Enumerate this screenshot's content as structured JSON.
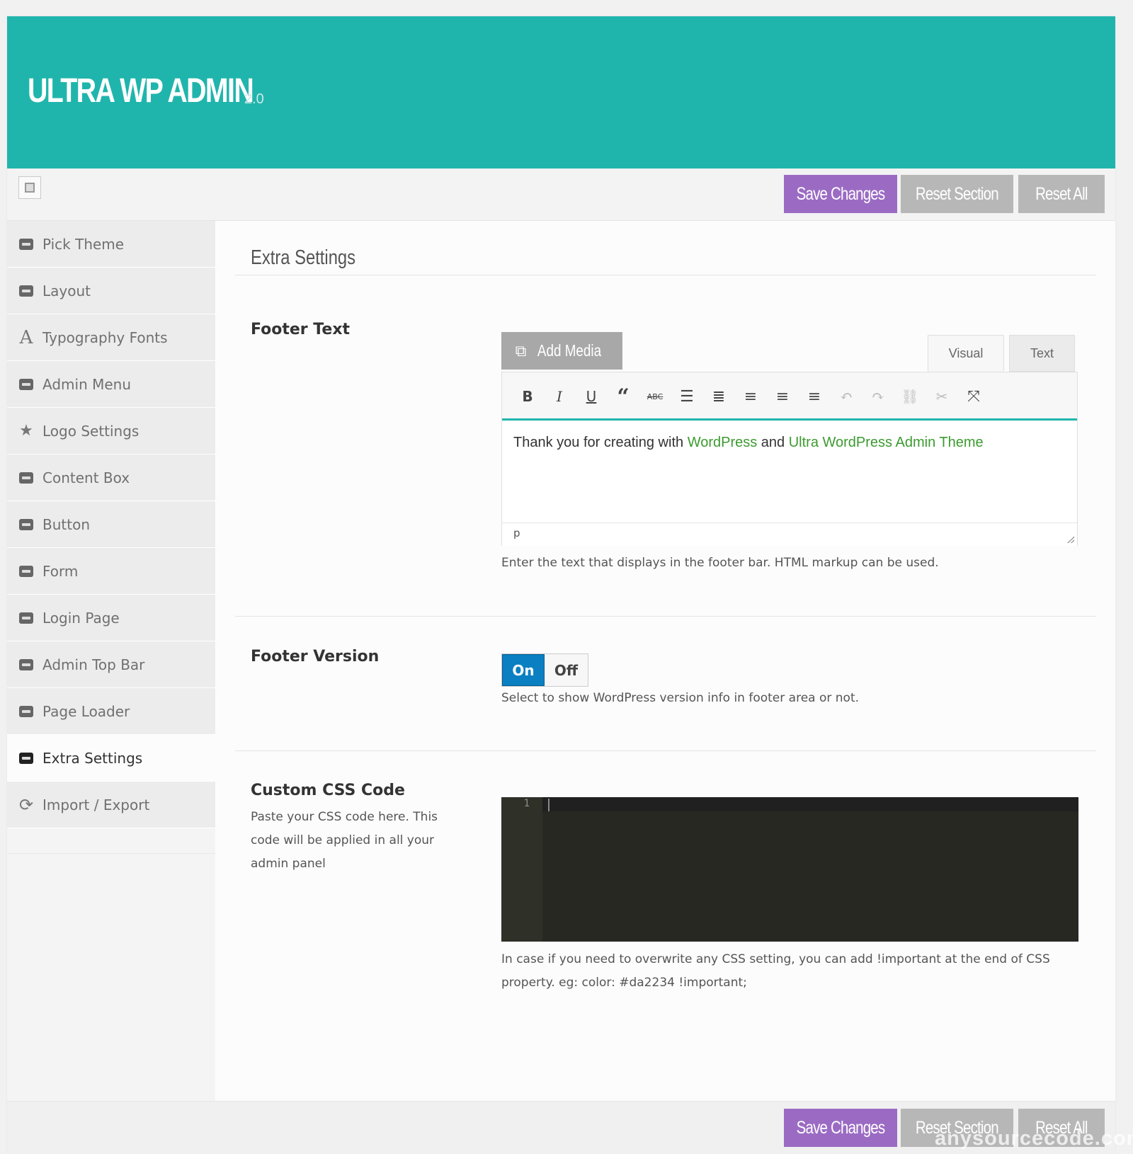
{
  "header": {
    "title": "ULTRA WP ADMIN",
    "version": "2.0",
    "background": "#20b5ac"
  },
  "toolbar": {
    "save_label": "Save Changes",
    "reset_section_label": "Reset Section",
    "reset_all_label": "Reset All"
  },
  "sidebar": {
    "items": [
      {
        "label": "Pick Theme",
        "icon": "css-icon"
      },
      {
        "label": "Layout",
        "icon": "css-icon"
      },
      {
        "label": "Typography Fonts",
        "icon": "font-icon"
      },
      {
        "label": "Admin Menu",
        "icon": "css-icon"
      },
      {
        "label": "Logo Settings",
        "icon": "star-icon"
      },
      {
        "label": "Content Box",
        "icon": "css-icon"
      },
      {
        "label": "Button",
        "icon": "css-icon"
      },
      {
        "label": "Form",
        "icon": "css-icon"
      },
      {
        "label": "Login Page",
        "icon": "css-icon"
      },
      {
        "label": "Admin Top Bar",
        "icon": "css-icon"
      },
      {
        "label": "Page Loader",
        "icon": "css-icon"
      },
      {
        "label": "Extra Settings",
        "icon": "css-icon",
        "active": true
      },
      {
        "label": "Import / Export",
        "icon": "refresh-icon"
      }
    ]
  },
  "main": {
    "section_title": "Extra Settings",
    "footer_text": {
      "label": "Footer Text",
      "add_media_label": "Add Media",
      "tab_visual": "Visual",
      "tab_text": "Text",
      "content_prefix": "Thank you for creating with ",
      "link1": "WordPress",
      "content_mid": " and ",
      "link2": "Ultra WordPress Admin Theme",
      "status_path": "p",
      "description": "Enter the text that displays in the footer bar. HTML markup can be used."
    },
    "footer_version": {
      "label": "Footer Version",
      "on_label": "On",
      "off_label": "Off",
      "value": "On",
      "description": "Select to show WordPress version info in footer area or not."
    },
    "custom_css": {
      "label": "Custom CSS Code",
      "subtitle": "Paste your CSS code here. This code will be applied in all your admin panel",
      "line_number": "1",
      "description": "In case if you need to overwrite any CSS setting, you can add !important at the end of CSS property. eg: color: #da2234 !important;"
    }
  },
  "colors": {
    "accent": "#20b5ac",
    "save": "#9b6bc4",
    "neutral": "#b7b7b7",
    "toggle_on": "#0a7fc2",
    "link": "#3b9b2f"
  },
  "watermark": "anysourcecode.com"
}
